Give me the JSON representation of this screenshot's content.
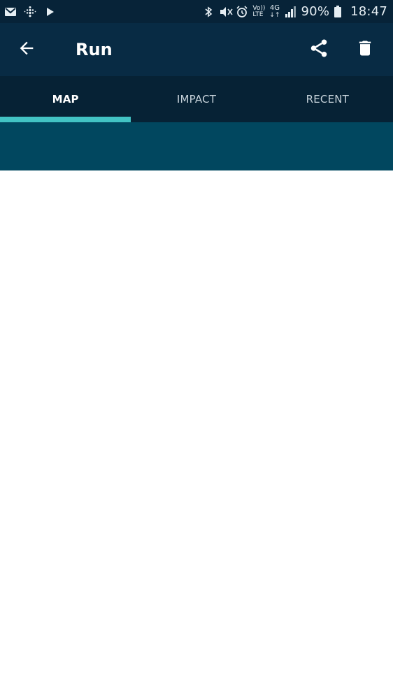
{
  "status_bar": {
    "battery_percent": "90%",
    "time": "18:47",
    "network_4g": "4G",
    "volte_top": "Vo))",
    "volte_bottom": "LTE",
    "icons": [
      "gmail-icon",
      "fitbit-icon",
      "play-icon",
      "bluetooth-icon",
      "mute-icon",
      "alarm-icon",
      "volte-icon",
      "network-4g-icon",
      "signal-icon",
      "battery-icon"
    ]
  },
  "app_bar": {
    "title": "Run",
    "icons": [
      "back-arrow-icon",
      "share-icon",
      "trash-icon"
    ]
  },
  "tabs": [
    {
      "label": "MAP",
      "active": true
    },
    {
      "label": "IMPACT",
      "active": false
    },
    {
      "label": "RECENT",
      "active": false
    }
  ],
  "colors": {
    "status_bar": "#072338",
    "app_bar": "#082b44",
    "tabs_bg": "#062235",
    "indicator": "#42c3c4",
    "banner": "#01475f",
    "content": "#ffffff"
  }
}
